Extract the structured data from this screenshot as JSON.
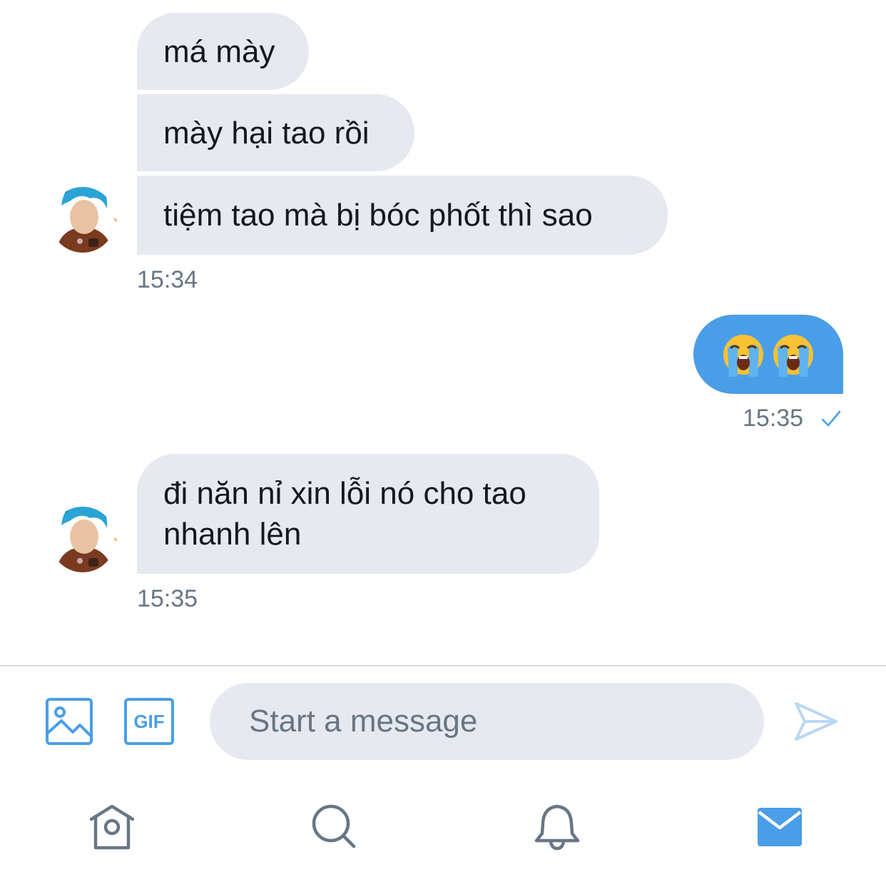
{
  "messages": [
    {
      "text": "má mày",
      "direction": "incoming"
    },
    {
      "text": "mày hại tao rồi",
      "direction": "incoming"
    },
    {
      "text": "tiệm tao mà bị bóc phốt thì sao",
      "direction": "incoming"
    },
    {
      "text": "😭😭",
      "direction": "outgoing"
    },
    {
      "text": "đi năn nỉ xin lỗi nó cho tao nhanh lên",
      "direction": "incoming"
    }
  ],
  "timestamps": {
    "group1": "15:34",
    "outgoing": "15:35",
    "group3": "15:35"
  },
  "composer": {
    "placeholder": "Start a message",
    "gif_label": "GIF"
  },
  "icons": {
    "image": "image-icon",
    "gif": "gif-icon",
    "send": "send-icon",
    "home": "home-icon",
    "search": "search-icon",
    "notifications": "bell-icon",
    "messages": "mail-icon",
    "read_receipt": "checkmark-icon"
  },
  "colors": {
    "incoming_bubble": "#e6e9ef",
    "outgoing_bubble": "#4a9ee8",
    "accent": "#4a9ee8",
    "muted_text": "#687684",
    "tab_icon": "#687684"
  }
}
